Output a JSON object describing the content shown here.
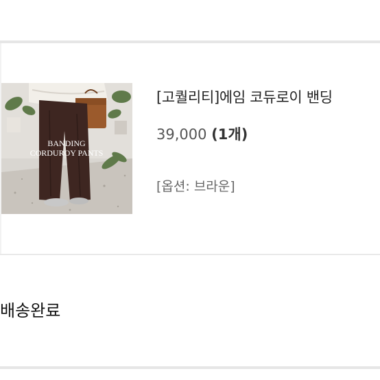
{
  "product": {
    "name": "[고퀄리티]에임 코듀로이 밴딩",
    "price": "39,000",
    "quantity": "(1개)",
    "option": "[옵션: 브라운]",
    "image": {
      "line1": "BANDING",
      "line2": "CORDUROY PANTS",
      "icon": "product-photo"
    }
  },
  "order": {
    "status": "배송완료"
  },
  "colors": {
    "divider": "#e6e6e6",
    "text_primary": "#222222",
    "text_secondary": "#555555"
  }
}
